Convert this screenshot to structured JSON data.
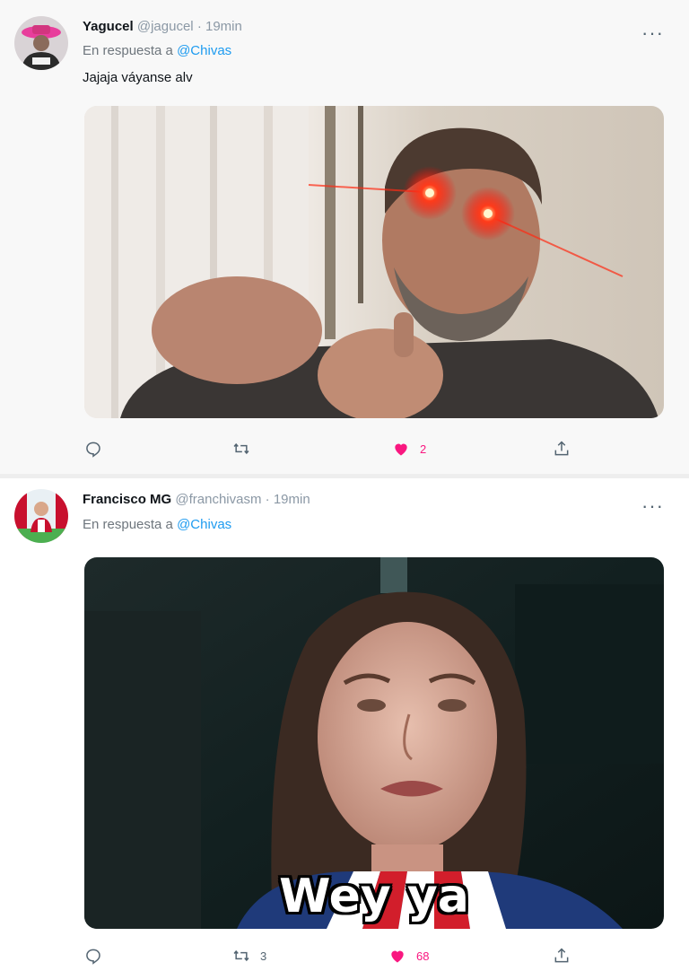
{
  "tweets": [
    {
      "display_name": "Yagucel",
      "handle": "@jagucel",
      "separator": "·",
      "time": "19min",
      "reply_prefix": "En respuesta a",
      "reply_to": "@Chivas",
      "text": "Jajaja váyanse alv",
      "media_description": "laser-eyes meme photo",
      "actions": {
        "replies": "",
        "retweets": "",
        "likes": "2",
        "liked": true
      },
      "more": "···"
    },
    {
      "display_name": "Francisco MG",
      "handle": "@franchivasm",
      "separator": "·",
      "time": "19min",
      "reply_prefix": "En respuesta a",
      "reply_to": "@Chivas",
      "media_caption": "Wey ya",
      "actions": {
        "replies": "",
        "retweets": "3",
        "likes": "68",
        "liked": true
      },
      "more": "···"
    }
  ],
  "icons": {
    "reply": "reply-icon",
    "retweet": "retweet-icon",
    "like": "heart-icon",
    "share": "share-icon",
    "more": "more-icon"
  },
  "colors": {
    "mention": "#1d9bf0",
    "like": "#f91880",
    "muted": "#536471"
  }
}
